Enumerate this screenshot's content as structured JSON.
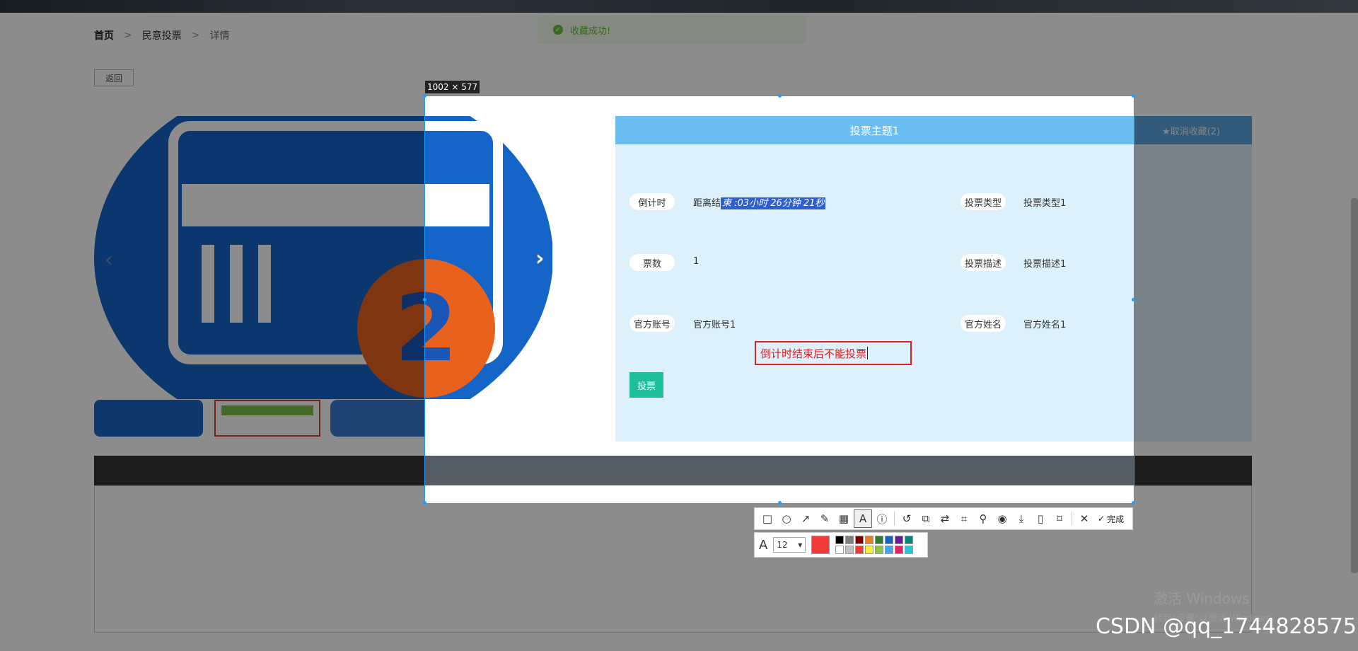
{
  "breadcrumb": {
    "home": "首页",
    "section": "民意投票",
    "current": "详情"
  },
  "back_label": "返回",
  "toast": "收藏成功!",
  "collect_label": "★取消收藏(2)",
  "selection_size": "1002 × 577",
  "vote": {
    "title": "投票主题1",
    "countdown_label": "倒计时",
    "countdown_prefix": "距离结",
    "countdown_value": "束 :03小时 26分钟 21秒",
    "type_label": "投票类型",
    "type_value": "投票类型1",
    "count_label": "票数",
    "count_value": "1",
    "desc_label": "投票描述",
    "desc_value": "投票描述1",
    "account_label": "官方账号",
    "account_value": "官方账号1",
    "name_label": "官方姓名",
    "name_value": "官方姓名1",
    "vote_button": "投票"
  },
  "annotation_text": "倒计时结束后不能投票",
  "toolbar": {
    "done_label": "完成",
    "tools": [
      "rectangle-icon",
      "ellipse-icon",
      "arrow-icon",
      "pencil-icon",
      "mosaic-icon",
      "text-icon",
      "serial-number-icon",
      "undo-icon",
      "long-screenshot-icon",
      "translate-icon",
      "ocr-icon",
      "pin-icon",
      "record-icon",
      "download-icon",
      "phone-icon",
      "bookmark-icon"
    ]
  },
  "text_props": {
    "font_size": "12"
  },
  "colors": {
    "accent": "#1e9fff",
    "current": "#f23a3a",
    "palette": [
      "#000000",
      "#808080",
      "#800000",
      "#e67e22",
      "#2e7d32",
      "#1565c0",
      "#6a1b9a",
      "#00897b",
      "#ffffff",
      "#c0c0c0",
      "#f23a3a",
      "#ffeb3b",
      "#8bc34a",
      "#42a5f5",
      "#e91e63",
      "#26c6da"
    ]
  },
  "windows_notice": {
    "line1": "激活 Windows",
    "line2": "转到\"设置\"以激活 Windows。"
  },
  "watermark": "CSDN @qq_1744828575"
}
